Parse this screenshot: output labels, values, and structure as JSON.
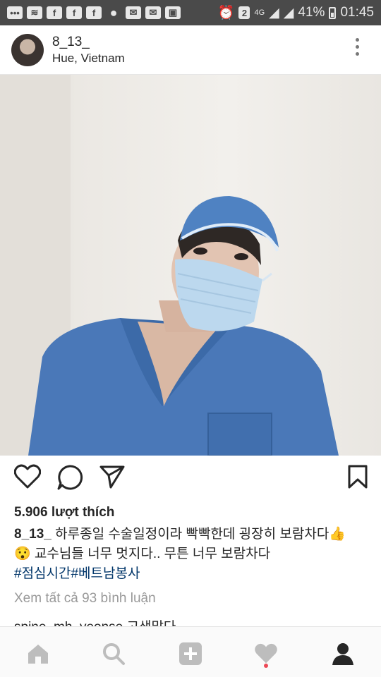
{
  "status_bar": {
    "left_icons": [
      "chat-icon",
      "wifi-icon",
      "facebook-icon",
      "facebook-icon",
      "facebook-icon",
      "messenger-icon",
      "mail-icon",
      "mail-icon",
      "gallery-icon"
    ],
    "sim_label": "2",
    "network": "4G",
    "battery": "41%",
    "time": "01:45"
  },
  "post": {
    "username": "8_13_",
    "location": "Hue, Vietnam",
    "likes": "5.906 lượt thích",
    "caption_user": "8_13_",
    "caption_line1": " 하루종일 수술일정이라 빡빡한데 굉장히 보람차다👍",
    "caption_line2": "😯 교수님들 너무 멋지다.. 무튼 너무 보람차다",
    "hashtags": "#점심시간#베트남봉사",
    "view_comments": "Xem tất cả 93 bình luận",
    "comment_peek": "spine_mh_yeonse 고생많다"
  },
  "colors": {
    "status_bar": "#4a4a4a",
    "hashtag": "#003569",
    "notification_dot": "#ed4956",
    "scrubs": "#4a78b8"
  }
}
